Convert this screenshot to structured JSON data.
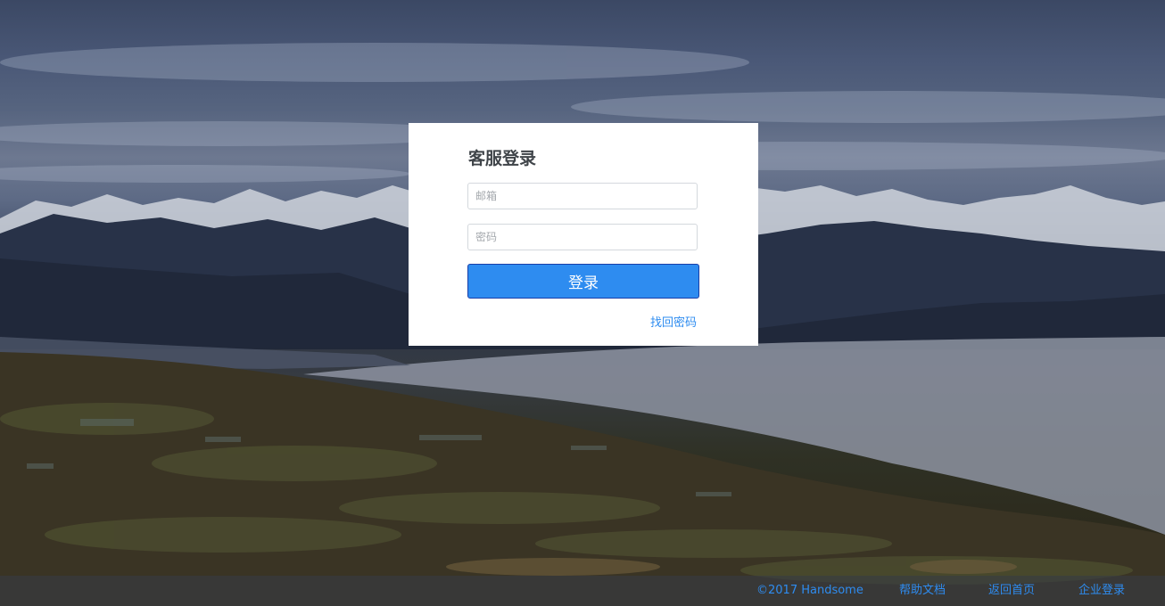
{
  "login": {
    "title": "客服登录",
    "email_placeholder": "邮箱",
    "password_placeholder": "密码",
    "submit_label": "登录",
    "recover_link": "找回密码"
  },
  "footer": {
    "copyright": "©2017 Handsome",
    "links": {
      "help": "帮助文档",
      "home": "返回首页",
      "enterprise_login": "企业登录"
    }
  },
  "colors": {
    "accent": "#2e8cf0",
    "card_background": "#ffffff",
    "footer_background": "#373c44"
  }
}
